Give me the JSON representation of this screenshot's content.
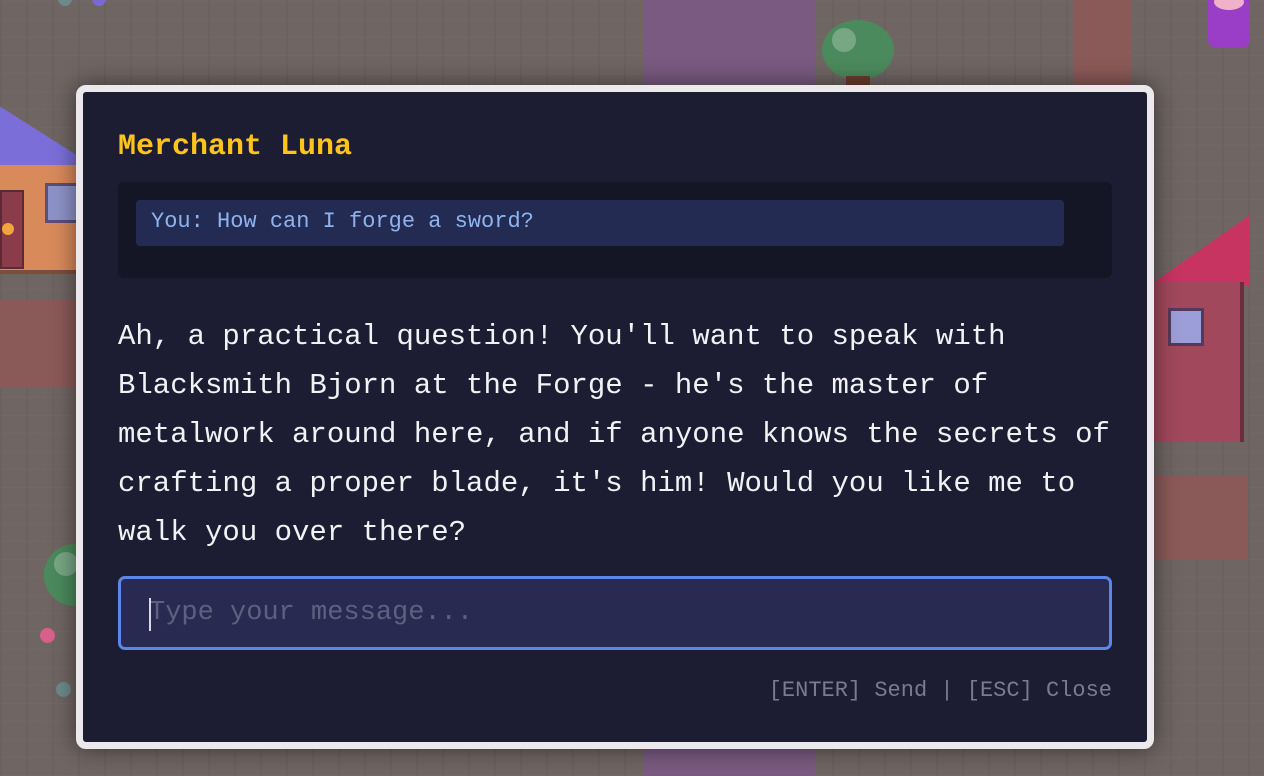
{
  "dialog": {
    "npc_name": "Merchant Luna",
    "history": [
      {
        "speaker": "You",
        "text": "You: How can I forge a sword?"
      }
    ],
    "npc_reply": "Ah, a practical question! You'll want to speak with Blacksmith Bjorn at the Forge - he's the master of metalwork around here, and if anyone knows the secrets of crafting a proper blade, it's him! Would you like me to walk you over there?",
    "input": {
      "placeholder": "Type your message...",
      "value": ""
    },
    "hints": {
      "send": "[ENTER] Send",
      "separator": "|",
      "close": "[ESC] Close"
    }
  },
  "world": {
    "colors": {
      "ground": "#6f6563",
      "path_purple": "#7a5a80",
      "roof_left": "#7c6ed9",
      "roof_right": "#c83462",
      "accent_name": "#ffc41a",
      "input_border": "#5b86ea"
    }
  }
}
